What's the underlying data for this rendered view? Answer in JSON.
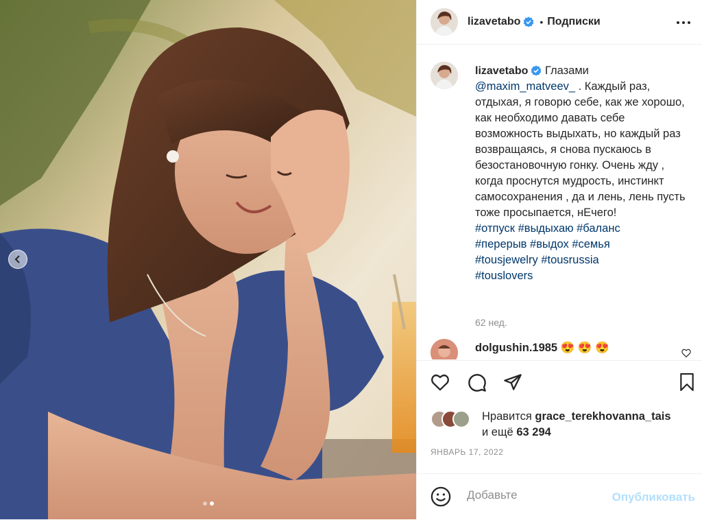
{
  "post": {
    "author": "lizavetabo",
    "follow_state": "Подписки",
    "separator": "•",
    "caption": {
      "first_line": "Глазами",
      "mention": "@maxim_matveev_",
      "body": " . Каждый раз, отдыхая, я говорю себе, как же хорошо, как необходимо давать себе возможность выдыхать, но каждый раз возвращаясь, я снова пускаюсь в безостановочную гонку. Очень жду , когда проснутся мудрость, инстинкт самосохранения , да и лень, лень пусть тоже просыпается, нЕчего!",
      "hashtags": [
        "#отпуск",
        "#выдыхаю",
        "#баланс",
        "#перерыв",
        "#выдох",
        "#семья",
        "#tousjewelry",
        "#tousrussia",
        "#touslovers"
      ],
      "time": "62 нед."
    },
    "comments": [
      {
        "user": "dolgushin.1985",
        "text": "😍 😍 😍"
      }
    ],
    "likes": {
      "prefix": "Нравится",
      "first_user": "grace_terekhovanna_tais",
      "and_more": "и ещё",
      "count": "63 294"
    },
    "date": "ЯНВАРЬ 17, 2022",
    "add_comment": {
      "placeholder": "Добавьте",
      "publish_label": "Опубликовать"
    },
    "carousel": {
      "total": 2,
      "active": 2
    }
  },
  "colors": {
    "text": "#262626",
    "secondary": "#8e8e8e",
    "link": "#00376b",
    "publish_disabled": "#b2dffc",
    "verified": "#3897f0",
    "border": "#efefef"
  }
}
